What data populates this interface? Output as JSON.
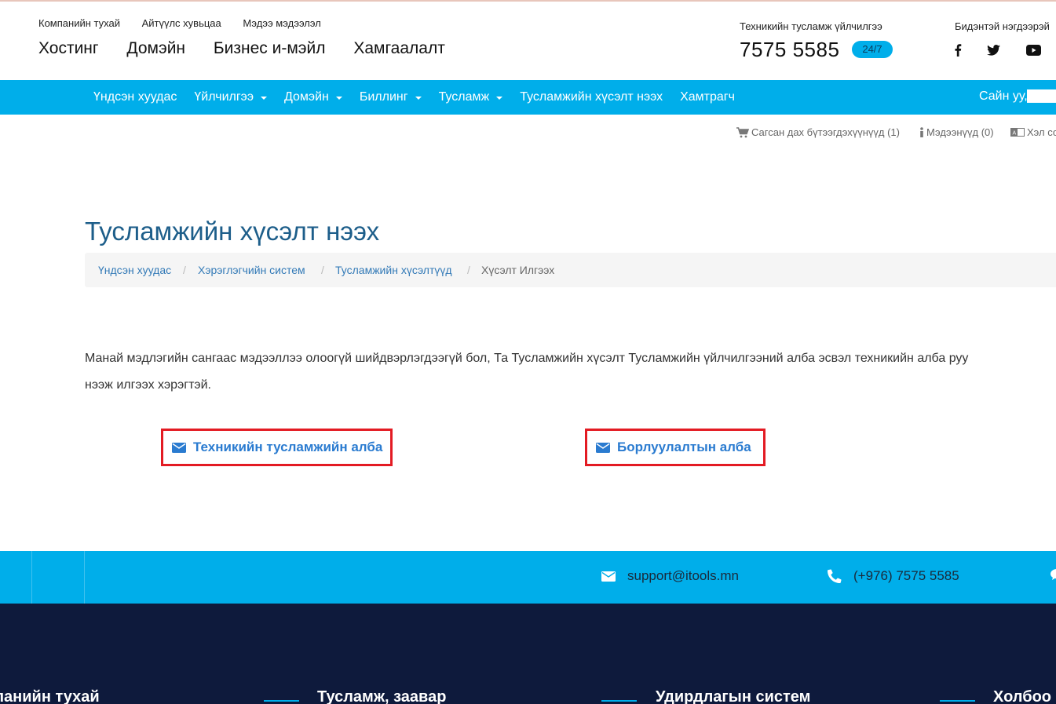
{
  "header": {
    "sub_links": [
      "Компанийн тухай",
      "Айтүүлс хувьцаа",
      "Мэдээ мэдээлэл"
    ],
    "main_links": [
      "Хостинг",
      "Домэйн",
      "Бизнес и-мэйл",
      "Хамгаалалт"
    ],
    "support_label": "Техникийн тусламж үйлчилгээ",
    "support_phone": "7575 5585",
    "support_badge": "24/7",
    "connect_label": "Бидэнтэй нэгдээрэй",
    "social_icons": [
      "facebook-icon",
      "twitter-icon",
      "youtube-icon"
    ]
  },
  "nav": {
    "items": [
      {
        "label": "Үндсэн хуудас",
        "dropdown": false
      },
      {
        "label": "Үйлчилгээ",
        "dropdown": true
      },
      {
        "label": "Домэйн",
        "dropdown": true
      },
      {
        "label": "Биллинг",
        "dropdown": true
      },
      {
        "label": "Тусламж",
        "dropdown": true
      },
      {
        "label": "Тусламжийн хүсэлт нээх",
        "dropdown": false
      },
      {
        "label": "Хамтрагч",
        "dropdown": false
      }
    ],
    "greeting": "Сайн уу,"
  },
  "utility": {
    "cart": "Сагсан дах бүтээгдэхүүнүүд (1)",
    "notifications": "Мэдээнүүд (0)",
    "language": "Хэл сонгох"
  },
  "page": {
    "title": "Тусламжийн хүсэлт нээх",
    "breadcrumb": [
      "Үндсэн хуудас",
      "Хэрэглэгчийн систем",
      "Тусламжийн хүсэлтүүд",
      "Хүсэлт Илгээх"
    ],
    "intro_line1": "Манай мэдлэгийн сангаас мэдээллээ олоогүй шийдвэрлэгдээгүй бол, Та Тусламжийн хүсэлт Тусламжийн үйлчилгээний алба эсвэл техникийн алба руу",
    "intro_line2": "нээж илгээх хэрэгтэй.",
    "departments": [
      "Техникийн тусламжийн алба",
      "Борлуулалтын алба"
    ]
  },
  "contact": {
    "email": "support@itools.mn",
    "phone": "(+976) 7575 5585"
  },
  "footer": {
    "columns": [
      "Компанийн тухай",
      "Тусламж, заавар",
      "Удирдлагын систем",
      "Холбоо барих"
    ]
  },
  "colors": {
    "accent": "#00aeea",
    "title": "#1d5e8a",
    "link": "#337ab7",
    "highlight_border": "#e31b23",
    "footer_bg": "#0e1a3c"
  }
}
